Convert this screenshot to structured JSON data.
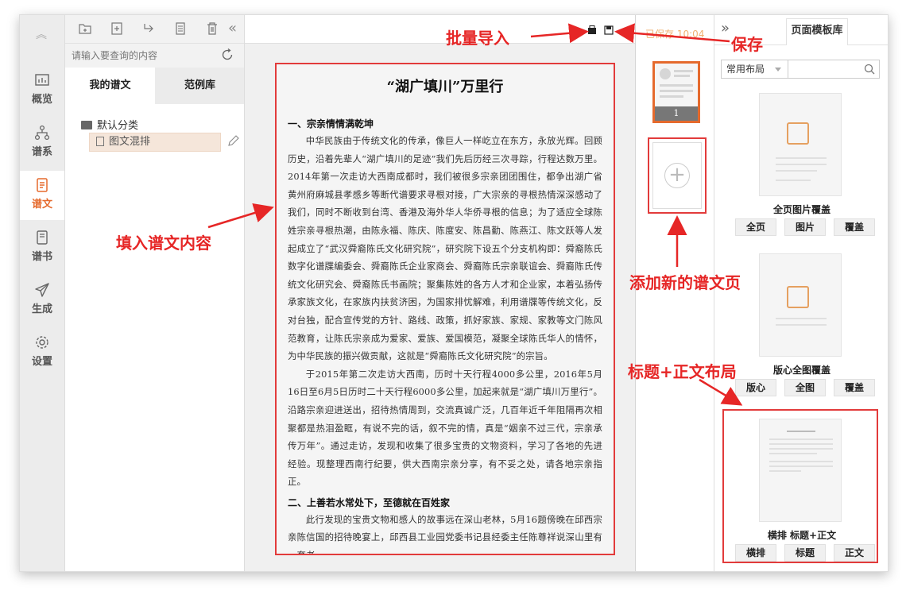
{
  "nav": {
    "items": [
      {
        "label": "概览",
        "icon": "bar-chart-icon"
      },
      {
        "label": "谱系",
        "icon": "tree-icon"
      },
      {
        "label": "谱文",
        "icon": "document-icon"
      },
      {
        "label": "谱书",
        "icon": "book-icon"
      },
      {
        "label": "生成",
        "icon": "send-icon"
      },
      {
        "label": "设置",
        "icon": "gear-icon"
      }
    ]
  },
  "files": {
    "search_placeholder": "请输入要查询的内容",
    "tabs": [
      "我的谱文",
      "范例库"
    ],
    "folder": "默认分类",
    "item": "图文混排"
  },
  "editor": {
    "saved_status": "已保存 10:04",
    "title": "“湖广填川”万里行",
    "sections": [
      {
        "type": "h2",
        "text": "一、宗亲情情满乾坤"
      },
      {
        "type": "p",
        "text": "中华民族由于传统文化的传承，像巨人一样屹立在东方，永放光辉。回顾历史，沿着先辈人“湖广填川的足迹”我们先后历经三次寻踪，行程达数万里。2014年第一次走访大西南成都时，我们被很多宗亲团团围住，都争出湖广省黄州府麻城县孝感乡等断代谱要求寻根对接，广大宗亲的寻根热情深深感动了我们，同时不断收到台湾、香港及海外华人华侨寻根的信息；为了适应全球陈姓宗亲寻根热潮，由陈永福、陈庆、陈度安、陈昌勤、陈燕江、陈文跃等人发起成立了“武汉舜裔陈氏文化研究院”，研究院下设五个分支机构即：舜裔陈氏数字化谱牒编委会、舜裔陈氏企业家商会、舜裔陈氏宗亲联谊会、舜裔陈氏传统文化研究会、舜裔陈氏书画院；聚集陈姓的各方人才和企业家，本着弘扬传承家族文化，在家族内扶贫济困，为国家排忧解难，利用谱牒等传统文化，反对台独，配合宣传党的方针、路线、政策，抓好家族、家规、家教等文门陈风范教育，让陈氏宗亲成为爱家、爱族、爱国模范，凝聚全球陈氏华人的情怀，为中华民族的振兴做贡献，这就是“舜裔陈氏文化研究院”的宗旨。"
      },
      {
        "type": "p",
        "text": "于2015年第二次走访大西南，历时十天行程4000多公里，2016年5月16日至6月5日历时二十天行程6000多公里，加起来就是“湖广填川万里行”。沿路宗亲迎进送出，招待热情周到，交流真诚广泛，几百年近千年阻隔再次相聚都是热泪盈眶，有说不完的话，叙不完的情，真是“姻亲不过三代，宗亲承传万年”。通过走访，发现和收集了很多宝贵的文物资料，学习了各地的先进经验。现整理西南行纪要，供大西南宗亲分享，有不妥之处，请各地宗亲指正。"
      },
      {
        "type": "h2",
        "text": "二、上善若水常处下，至德就在百姓家"
      },
      {
        "type": "p",
        "text": "此行发现的宝贵文物和感人的故事远在深山老林，5月16题傍晚在邱西宗亲陈信国的招待晚宴上，邱西县工业园党委书记县经委主任陈尊祥说深山里有一套老"
      }
    ]
  },
  "thumbs": {
    "page_number": "1"
  },
  "library": {
    "tab": "页面模板库",
    "filter": "常用布局",
    "templates": [
      {
        "title": "全页图片覆盖",
        "buttons": [
          "全页",
          "图片",
          "覆盖"
        ]
      },
      {
        "title": "版心全图覆盖",
        "buttons": [
          "版心",
          "全图",
          "覆盖"
        ]
      },
      {
        "title": "横排 标题+正文",
        "buttons": [
          "横排",
          "标题",
          "正文"
        ]
      }
    ]
  },
  "annotations": {
    "batch_import": "批量导入",
    "save": "保存",
    "fill_content": "填入谱文内容",
    "add_page": "添加新的谱文页",
    "title_layout": "标题+正文布局"
  },
  "colors": {
    "accent": "#e56a2d",
    "annotation": "#e62626"
  }
}
